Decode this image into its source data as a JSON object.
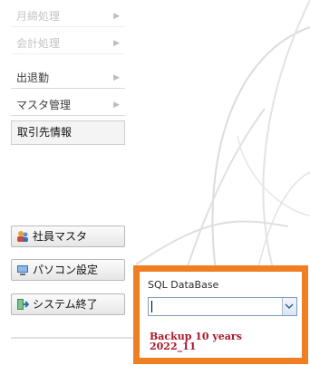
{
  "menu": {
    "items": [
      {
        "label": "月締処理",
        "faded": true
      },
      {
        "label": "会計処理",
        "faded": true
      },
      {
        "label": "出退勤",
        "faded": false
      },
      {
        "label": "マスタ管理",
        "faded": false
      },
      {
        "label": "取引先情報",
        "faded": false
      }
    ]
  },
  "buttons": {
    "employee_master": {
      "label": "社員マスタ",
      "icon": "people-icon"
    },
    "pc_settings": {
      "label": "パソコン設定",
      "icon": "monitor-icon"
    },
    "system_exit": {
      "label": "システム終了",
      "icon": "exit-icon"
    }
  },
  "db_panel": {
    "title": "SQL DataBase",
    "value": "",
    "backup_line1": "Backup 10 years",
    "backup_line2": "2022_11"
  },
  "colors": {
    "highlight_border": "#f07f24",
    "backup_text": "#a8182b",
    "combo_border": "#7a9cc0"
  }
}
